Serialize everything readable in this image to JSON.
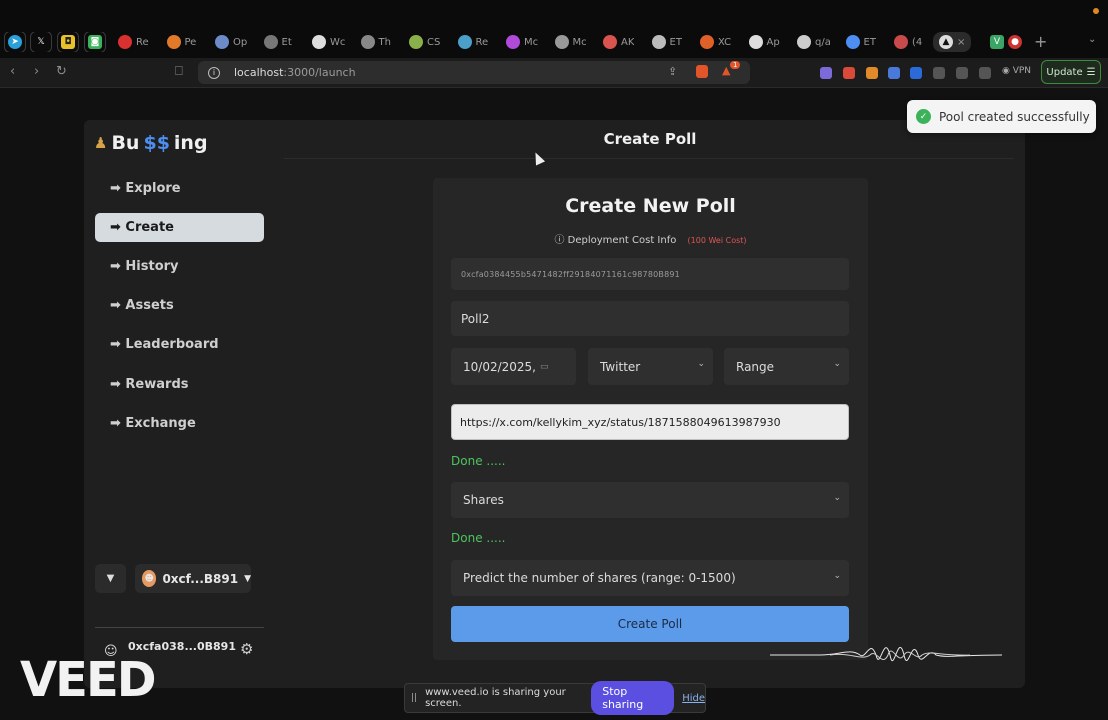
{
  "browser": {
    "tabs": [
      {
        "label": "Re",
        "color": "#d93030"
      },
      {
        "label": "Pe",
        "color": "#e07a2a"
      },
      {
        "label": "Op",
        "color": "#6d8ac9"
      },
      {
        "label": "Et",
        "color": "#777777"
      },
      {
        "label": "Wc",
        "color": "#dddddd"
      },
      {
        "label": "Th",
        "color": "#888888"
      },
      {
        "label": "CS",
        "color": "#8ab04a"
      },
      {
        "label": "Re",
        "color": "#4aa0c9"
      },
      {
        "label": "Mc",
        "color": "#b04ad9"
      },
      {
        "label": "Mc",
        "color": "#999999"
      },
      {
        "label": "AK",
        "color": "#d9534f"
      },
      {
        "label": "ET",
        "color": "#bbbbbb"
      },
      {
        "label": "XC",
        "color": "#e0602a"
      },
      {
        "label": "Ap",
        "color": "#dddddd"
      },
      {
        "label": "q/a",
        "color": "#cccccc"
      },
      {
        "label": "ET",
        "color": "#4d8ef0"
      },
      {
        "label": "(4",
        "color": "#c94a4a"
      }
    ],
    "active_tab_close": "×",
    "new_tab": "+",
    "url_host": "localhost",
    "url_path": ":3000/launch",
    "vpn_label": "VPN",
    "update_label": "Update",
    "notification_count": "1"
  },
  "toast": {
    "message": "Pool created successfully"
  },
  "sidebar": {
    "brand_prefix": "Bu",
    "brand_money": "$$",
    "brand_suffix": "ing",
    "items": [
      {
        "label": "➡ Explore"
      },
      {
        "label": "➡ Create"
      },
      {
        "label": "➡ History"
      },
      {
        "label": "➡ Assets"
      },
      {
        "label": "➡ Leaderboard"
      },
      {
        "label": "➡ Rewards"
      },
      {
        "label": "➡ Exchange"
      }
    ],
    "wallet_short": "0xcf...B891",
    "account_address": "0xcfa038...0B891"
  },
  "header": {
    "title": "Create Poll"
  },
  "form": {
    "title": "Create New Poll",
    "cost_info": "Deployment Cost Info",
    "cost_value": "(100 Wei Cost)",
    "address_value": "0xcfa0384455b5471482ff29184071161c98780B891",
    "poll_name": "Poll2",
    "date_value": "10/02/2025,",
    "platform": "Twitter",
    "poll_type": "Range",
    "url_value": "https://x.com/kellykim_xyz/status/1871588049613987930",
    "done_label_1": "Done .....",
    "metric": "Shares",
    "done_label_2": "Done .....",
    "question": "Predict the number of shares (range: 0-1500)",
    "submit_label": "Create Poll"
  },
  "screen_share": {
    "message": "www.veed.io is sharing your screen.",
    "stop_label": "Stop sharing",
    "hide_label": "Hide"
  },
  "watermark": "VEED",
  "colors": {
    "accent_blue": "#5b9bea",
    "success_green": "#4cc45c",
    "cost_red": "#e05555"
  }
}
